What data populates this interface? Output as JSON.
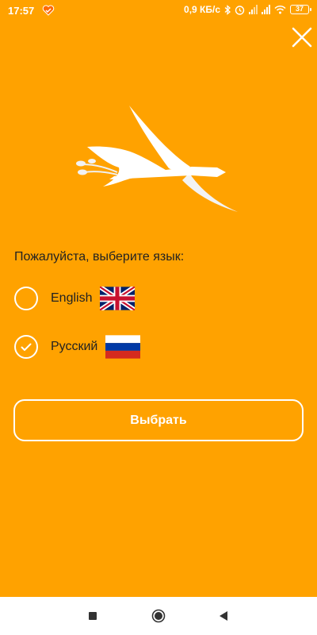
{
  "status_bar": {
    "time": "17:57",
    "network_speed": "0,9 КБ/с",
    "battery_level": "37",
    "icons": [
      "heart-app-icon",
      "bluetooth-icon",
      "alarm-icon",
      "signal-icon",
      "signal-icon",
      "wifi-icon",
      "battery-icon"
    ]
  },
  "header": {
    "close_icon": "close-icon"
  },
  "language_picker": {
    "prompt": "Пожалуйста, выберите язык:",
    "options": [
      {
        "label": "English",
        "flag": "uk-flag-icon",
        "selected": false
      },
      {
        "label": "Русский",
        "flag": "russia-flag-icon",
        "selected": true
      }
    ],
    "select_button": "Выбрать"
  },
  "nav_bar": {
    "icons": [
      "recents-square-icon",
      "home-circle-icon",
      "back-triangle-icon"
    ]
  },
  "colors": {
    "background": "#ffa200",
    "text": "#222222",
    "accent": "#ffffff",
    "nav_background": "#ffffff",
    "nav_icon": "#333333"
  }
}
